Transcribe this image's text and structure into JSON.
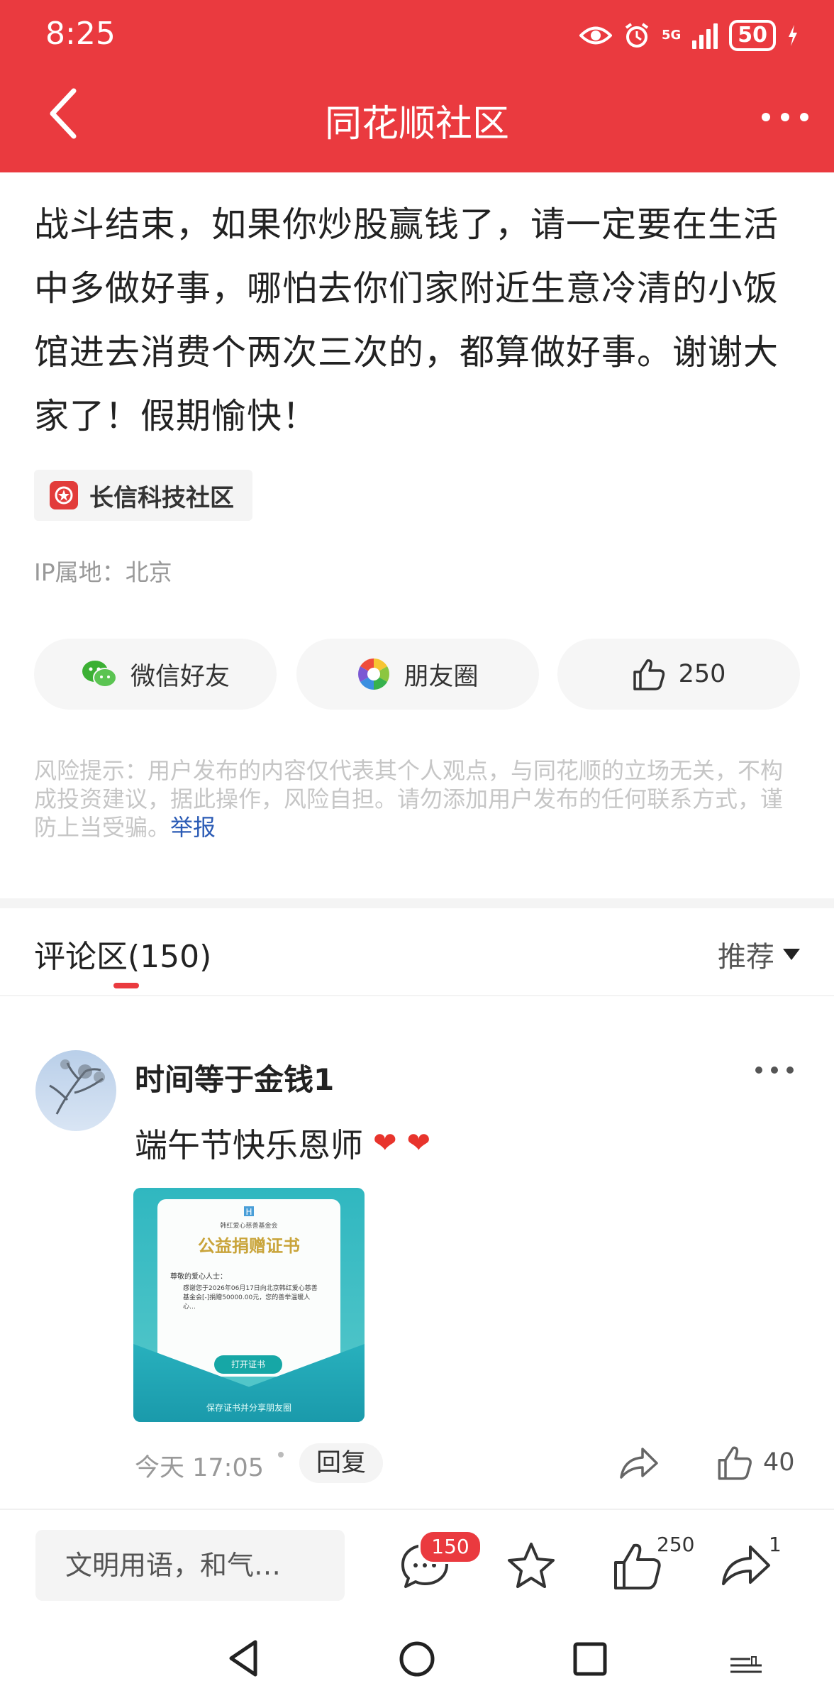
{
  "status_bar": {
    "time": "8:25",
    "battery": "50",
    "network": "5G"
  },
  "header": {
    "title": "同花顺社区"
  },
  "post": {
    "text": "战斗结束，如果你炒股赢钱了，请一定要在生活中多做好事，哪怕去你们家附近生意冷清的小饭馆进去消费个两次三次的，都算做好事。谢谢大家了！假期愉快！",
    "topic": "长信科技社区",
    "ip_location": "IP属地：北京",
    "share_wechat": "微信好友",
    "share_moments": "朋友圈",
    "likes": "250",
    "risk_notice": "风险提示：用户发布的内容仅代表其个人观点，与同花顺的立场无关，不构成投资建议，据此操作，风险自担。请勿添加用户发布的任何联系方式，谨防上当受骗。",
    "report_label": "举报"
  },
  "comments": {
    "title": "评论区(150)",
    "sort_label": "推荐",
    "items": [
      {
        "username": "时间等于金钱1",
        "text": "端午节快乐恩师",
        "time": "今天 17:05",
        "reply_label": "回复",
        "likes": "40",
        "certificate": {
          "org": "韩红爱心慈善基金会",
          "title": "公益捐赠证书",
          "greeting": "尊敬的爱心人士：",
          "body": "感谢您于2026年06月17日向北京韩红爱心慈善基金会[-]捐赠50000.00元，您的善举温暖人心…",
          "button": "打开证书",
          "footer": "保存证书并分享朋友圈"
        }
      }
    ]
  },
  "bottom_bar": {
    "input_placeholder": "文明用语，和气…",
    "comment_count": "150",
    "like_count": "250",
    "share_count": "1"
  },
  "colors": {
    "brand_red": "#ea3a3f",
    "report_link": "#2b5bb5"
  }
}
